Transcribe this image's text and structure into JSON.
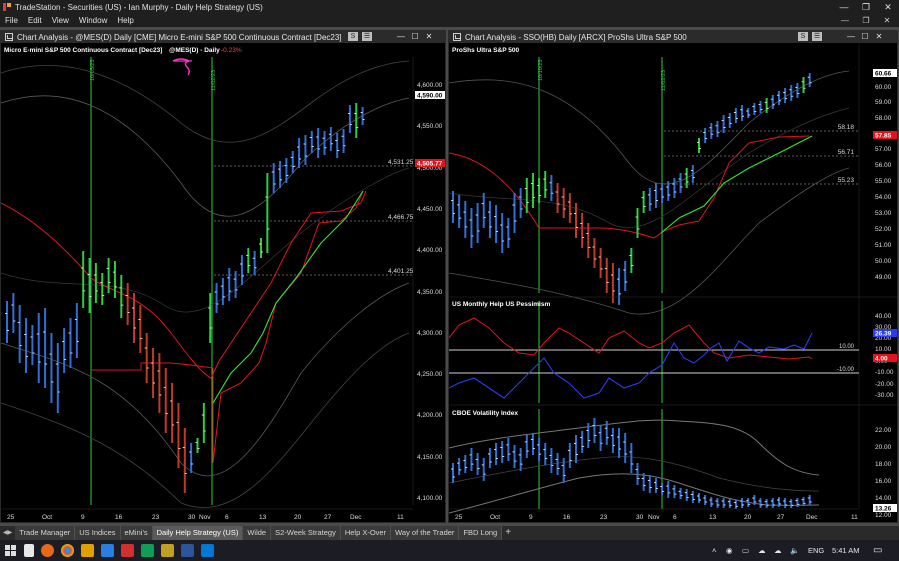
{
  "app": {
    "title": "TradeStation - Securities (US) - Ian Murphy - Daily Help Strategy (US)"
  },
  "menu": [
    "File",
    "Edit",
    "View",
    "Window",
    "Help"
  ],
  "left_chart": {
    "window_title": "Chart Analysis - @MES(D) Daily [CME] Micro E-mini S&P 500 Continuous Contract [Dec23]",
    "header_name": "Micro E-mini S&P 500 Continuous Contract [Dec23]",
    "header_symbol": "@MES(D) - Daily",
    "header_change": "-0.23%",
    "vline_labels": [
      "10/03/23",
      "11/02/23"
    ],
    "price_axis": [
      "4,600.00",
      "4,550.00",
      "4,500.00",
      "4,450.00",
      "4,400.00",
      "4,350.00",
      "4,300.00",
      "4,250.00",
      "4,200.00",
      "4,150.00",
      "4,100.00"
    ],
    "level_labels": [
      "4,531.25",
      "4,466.75",
      "4,401.25"
    ],
    "last_price_tag": "4,590.00",
    "red_line_tag": "4,505.77",
    "date_axis": [
      "25",
      "Oct",
      "9",
      "16",
      "23",
      "30",
      "Nov",
      "6",
      "13",
      "20",
      "27",
      "Dec",
      "11"
    ]
  },
  "right_chart": {
    "window_title": "Chart Analysis - SSO(HB) Daily [ARCX] ProShs Ultra S&P 500",
    "header_name": "ProShs Ultra S&P 500",
    "vline_labels": [
      "10/10/23",
      "11/02/23"
    ],
    "price_axis": [
      "60.00",
      "59.00",
      "58.00",
      "57.00",
      "56.00",
      "55.00",
      "54.00",
      "53.00",
      "52.00",
      "51.00",
      "50.00",
      "49.00"
    ],
    "price_tags": [
      "60.66",
      "57.85"
    ],
    "level_labels": [
      "58.18",
      "56.71",
      "55.23"
    ],
    "indicator_title": "US Monthly Help  US Pessimism",
    "indicator_axis": [
      "40.00",
      "30.00",
      "20.00",
      "10.00",
      "0.00",
      "-10.00",
      "-20.00",
      "-30.00"
    ],
    "indicator_tags": [
      "26.39",
      "4.00"
    ],
    "indicator_levels": [
      "10.00",
      "-10.00"
    ],
    "vix_title": "CBOE Volatility Index",
    "vix_axis": [
      "22.00",
      "20.00",
      "18.00",
      "16.00",
      "14.00",
      "12.00"
    ],
    "vix_tag": "13.26",
    "date_axis": [
      "25",
      "Oct",
      "9",
      "16",
      "23",
      "30",
      "Nov",
      "6",
      "13",
      "20",
      "27",
      "Dec",
      "11"
    ]
  },
  "tabs": [
    "Trade Manager",
    "US Indices",
    "eMini's",
    "Daily Help Strategy (US)",
    "Wilde",
    "S2-Week Strategy",
    "Help X-Over",
    "Way of the Trader",
    "FBD Long"
  ],
  "active_tab": "Daily Help Strategy (US)",
  "taskbar": {
    "language": "ENG",
    "time": "5:41 AM"
  },
  "colors": {
    "up_bar": "#2f6fd6",
    "up_bar_green": "#2ecc40",
    "down_bar": "#c0392b",
    "red_line": "#e0141e",
    "green_line": "#32e632",
    "vline": "#2ecc40",
    "indicator_red": "#e0141e",
    "indicator_blue": "#2a3cf0"
  }
}
